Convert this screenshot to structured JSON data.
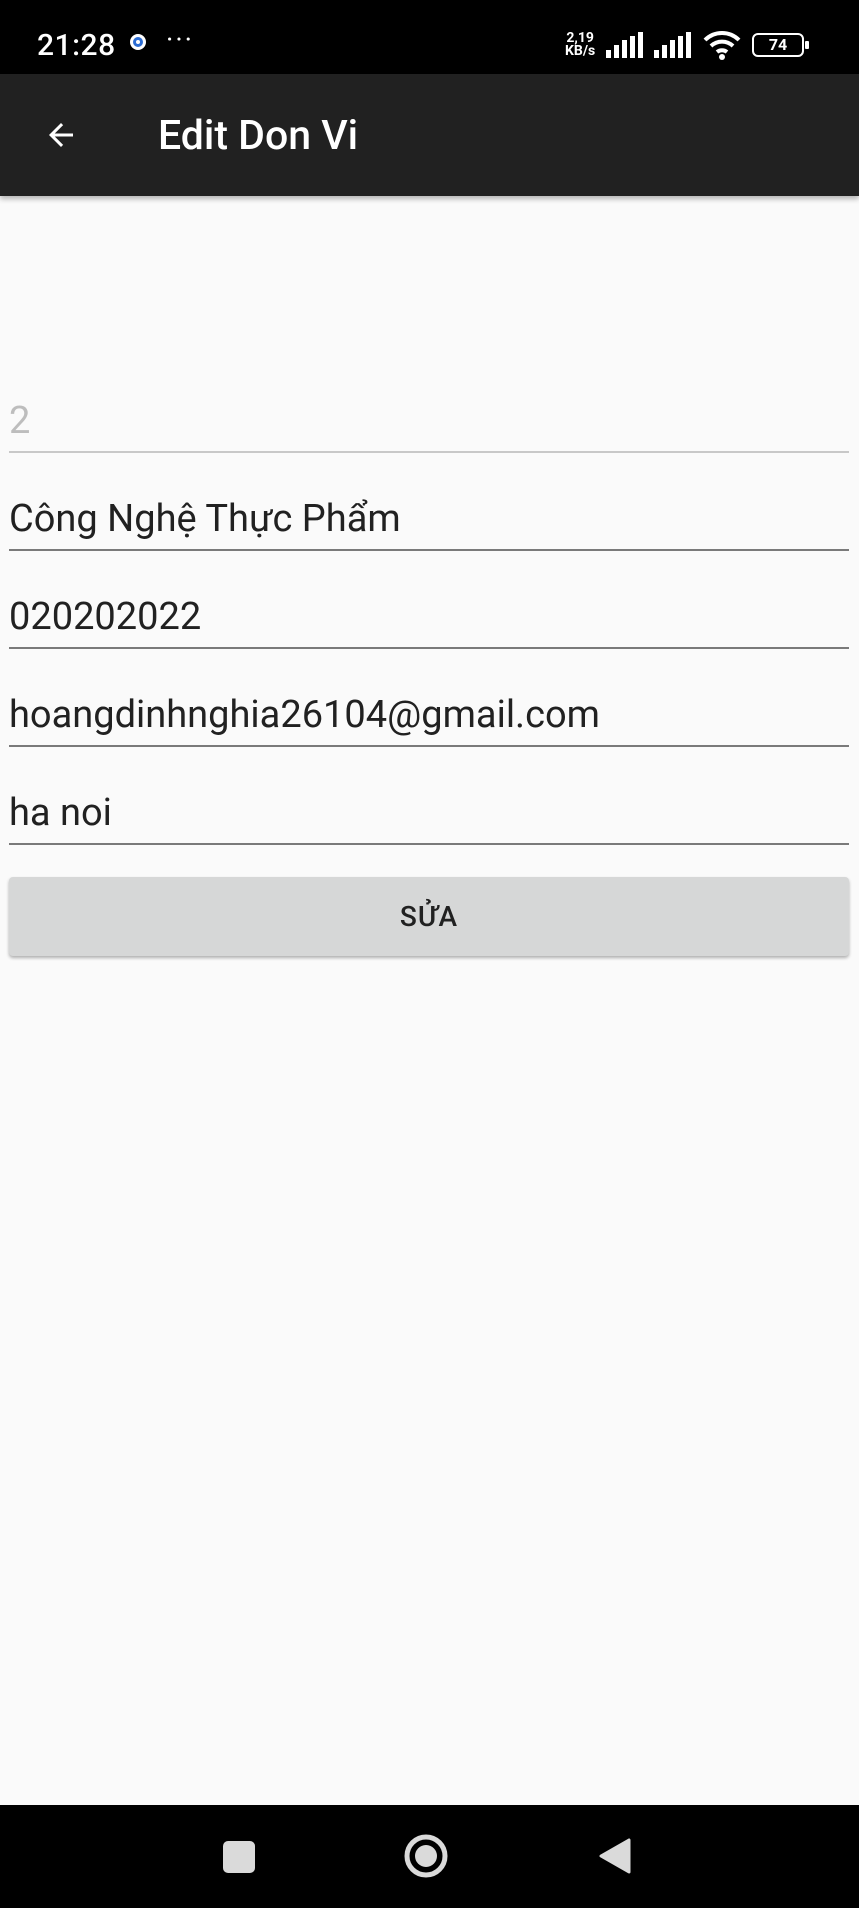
{
  "status_bar": {
    "time": "21:28",
    "more": "···",
    "net_speed_value": "2,19",
    "net_speed_unit": "KB/s",
    "battery": "74"
  },
  "app_bar": {
    "title": "Edit Don Vi",
    "back_icon": "arrow-back-icon"
  },
  "form": {
    "id_value": "2",
    "name_value": "Công Nghệ Thực Phẩm",
    "phone_value": "020202022",
    "email_value": "hoangdinhnghia26104@gmail.com",
    "address_value": "ha noi",
    "submit_label": "SỬA"
  },
  "nav_bar": {
    "recent_icon": "square-recent-apps-icon",
    "home_icon": "circle-home-icon",
    "back_icon": "triangle-back-icon"
  }
}
